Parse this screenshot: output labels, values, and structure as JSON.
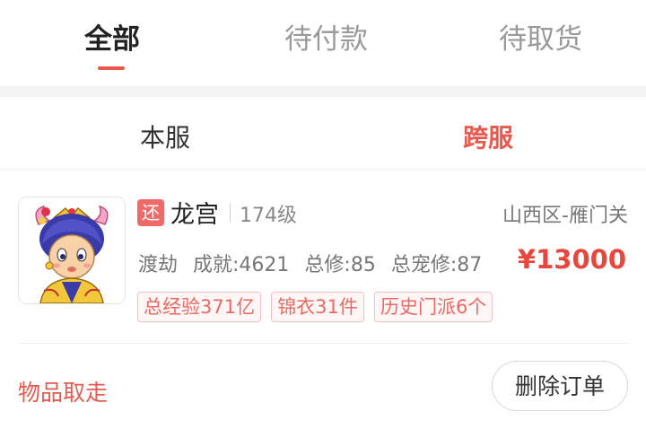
{
  "tabs": [
    {
      "label": "全部",
      "active": true
    },
    {
      "label": "待付款",
      "active": false
    },
    {
      "label": "待取货",
      "active": false
    }
  ],
  "subtabs": [
    {
      "label": "本服",
      "active": false
    },
    {
      "label": "跨服",
      "active": true
    }
  ],
  "order": {
    "badge": "还",
    "school": "龙宫",
    "level": "174级",
    "server": "山西区-雁门关",
    "stats": [
      "渡劫",
      "成就:4621",
      "总修:85",
      "总宠修:87"
    ],
    "price": "¥13000",
    "tags": [
      "总经验371亿",
      "锦衣31件",
      "历史门派6个"
    ],
    "status": "物品取走",
    "delete_label": "删除订单"
  },
  "colors": {
    "accent": "#e85a4f",
    "price": "#e8473f",
    "tag_bg": "#fff6f5"
  }
}
